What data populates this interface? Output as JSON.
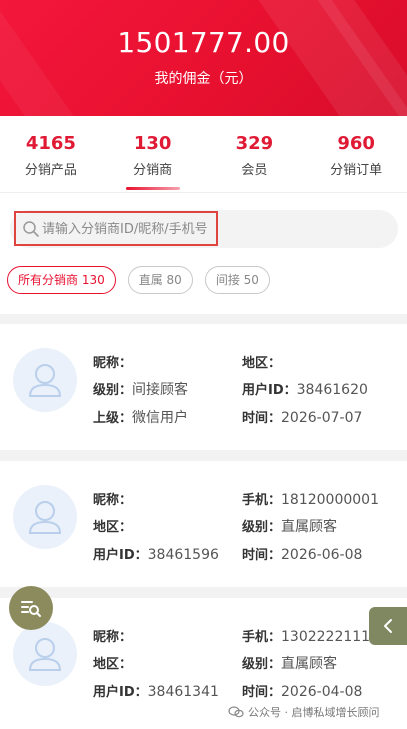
{
  "header": {
    "amount": "1501777.00",
    "amount_label": "我的佣金（元）"
  },
  "stats": [
    {
      "value": "4165",
      "label": "分销产品"
    },
    {
      "value": "130",
      "label": "分销商"
    },
    {
      "value": "329",
      "label": "会员"
    },
    {
      "value": "960",
      "label": "分销订单"
    }
  ],
  "active_stat": "分销商",
  "search": {
    "placeholder": "请输入分销商ID/昵称/手机号"
  },
  "filters": [
    {
      "label": "所有分销商 130",
      "active": true
    },
    {
      "label": "直属 80",
      "active": false
    },
    {
      "label": "间接 50",
      "active": false
    }
  ],
  "distributors": [
    {
      "rows": [
        [
          {
            "k": "昵称：",
            "v": ""
          },
          {
            "k": "地区：",
            "v": ""
          }
        ],
        [
          {
            "k": "级别：",
            "v": "间接顾客"
          },
          {
            "k": "用户ID：",
            "v": "38461620"
          }
        ],
        [
          {
            "k": "上级：",
            "v": "微信用户"
          },
          {
            "k": "时间：",
            "v": "2026-07-07"
          }
        ]
      ]
    },
    {
      "rows": [
        [
          {
            "k": "昵称：",
            "v": ""
          },
          {
            "k": "手机：",
            "v": "18120000001"
          }
        ],
        [
          {
            "k": "地区：",
            "v": ""
          },
          {
            "k": "级别：",
            "v": "直属顾客"
          }
        ],
        [
          {
            "k": "用户ID：",
            "v": "38461596"
          },
          {
            "k": "时间：",
            "v": "2026-06-08"
          }
        ]
      ]
    },
    {
      "rows": [
        [
          {
            "k": "昵称：",
            "v": ""
          },
          {
            "k": "手机：",
            "v": "13022221112"
          }
        ],
        [
          {
            "k": "地区：",
            "v": ""
          },
          {
            "k": "级别：",
            "v": "直属顾客"
          }
        ],
        [
          {
            "k": "用户ID：",
            "v": "38461341"
          },
          {
            "k": "时间：",
            "v": "2026-04-08"
          }
        ]
      ]
    }
  ],
  "watermark": "公众号 · 启博私域增长顾问",
  "colors": {
    "brand_red": "#e8102f",
    "fab_olive": "#8b8b5e"
  }
}
